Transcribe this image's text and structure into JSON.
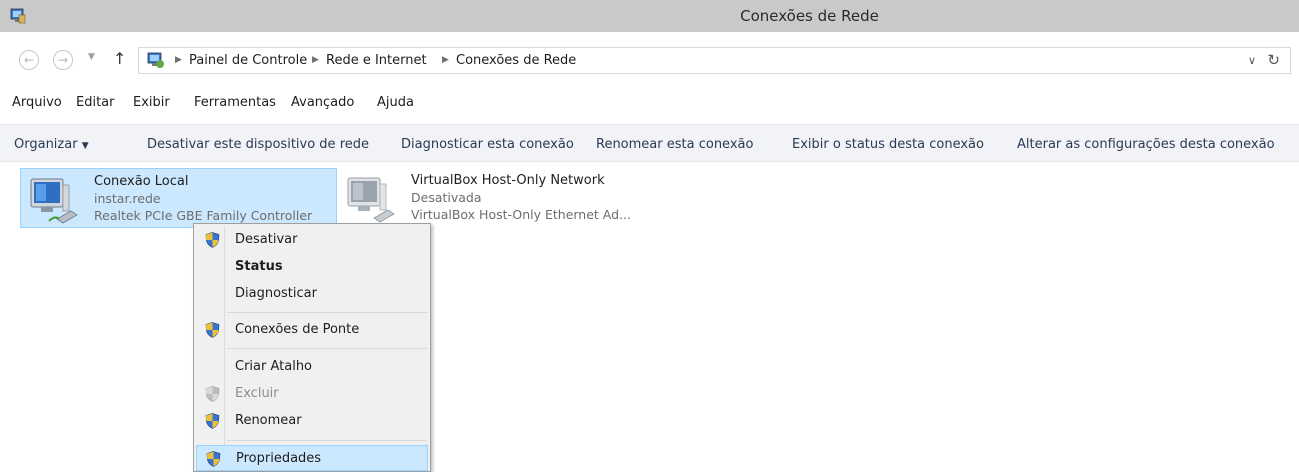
{
  "window": {
    "title": "Conexões de Rede"
  },
  "address": {
    "breadcrumbs": [
      "Painel de Controle",
      "Rede e Internet",
      "Conexões de Rede"
    ]
  },
  "menu": {
    "items": [
      "Arquivo",
      "Editar",
      "Exibir",
      "Ferramentas",
      "Avançado",
      "Ajuda"
    ]
  },
  "commands": {
    "organize": "Organizar",
    "items": [
      "Desativar este dispositivo de rede",
      "Diagnosticar esta conexão",
      "Renomear esta conexão",
      "Exibir o status desta conexão",
      "Alterar as configurações desta conexão"
    ]
  },
  "connections": [
    {
      "name": "Conexão Local",
      "status": "instar.rede",
      "device": "Realtek PCIe GBE Family Controller",
      "selected": true
    },
    {
      "name": "VirtualBox Host-Only Network",
      "status": "Desativada",
      "device": "VirtualBox Host-Only Ethernet Ad...",
      "selected": false
    }
  ],
  "context_menu": {
    "items": [
      {
        "label": "Desativar",
        "shield": true
      },
      {
        "label": "Status",
        "bold": true
      },
      {
        "label": "Diagnosticar"
      },
      {
        "label": "Conexões de Ponte",
        "shield": true
      },
      {
        "label": "Criar Atalho"
      },
      {
        "label": "Excluir",
        "shield": true,
        "disabled": true
      },
      {
        "label": "Renomear",
        "shield": true
      },
      {
        "label": "Propriedades",
        "shield": true,
        "hover": true
      }
    ]
  },
  "colors": {
    "selection": "#cce8ff",
    "selection_border": "#99d1ff",
    "titlebar": "#c9c9c9",
    "command_bar": "#f1f3f6"
  }
}
